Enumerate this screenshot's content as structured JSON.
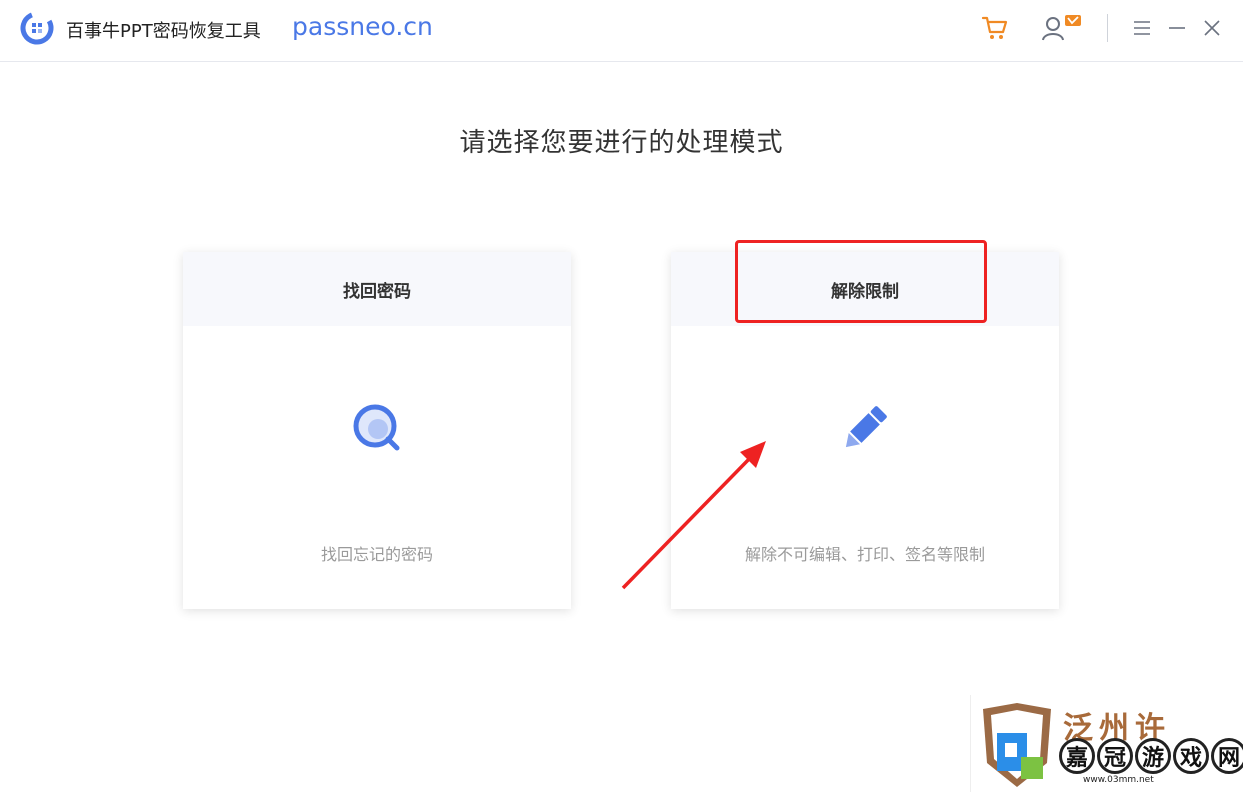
{
  "app": {
    "title": "百事牛PPT密码恢复工具",
    "domain": "passneo.cn"
  },
  "titlebar": {
    "icons": [
      "cart-icon",
      "user-vip-icon",
      "menu-icon",
      "minimize-icon",
      "close-icon"
    ]
  },
  "main": {
    "heading": "请选择您要进行的处理模式",
    "cards": [
      {
        "title": "找回密码",
        "description": "找回忘记的密码",
        "icon": "magnifier-icon"
      },
      {
        "title": "解除限制",
        "description": "解除不可编辑、打印、签名等限制",
        "icon": "pencil-icon"
      }
    ]
  },
  "watermark": {
    "top_text": "泛州许",
    "chars": [
      "嘉",
      "冠",
      "游",
      "戏",
      "网"
    ],
    "url": "www.03mm.net"
  },
  "colors": {
    "accent": "#4a78e6",
    "cart": "#f08a24",
    "annotation": "#ee2222",
    "card_header": "#f7f8fc"
  }
}
